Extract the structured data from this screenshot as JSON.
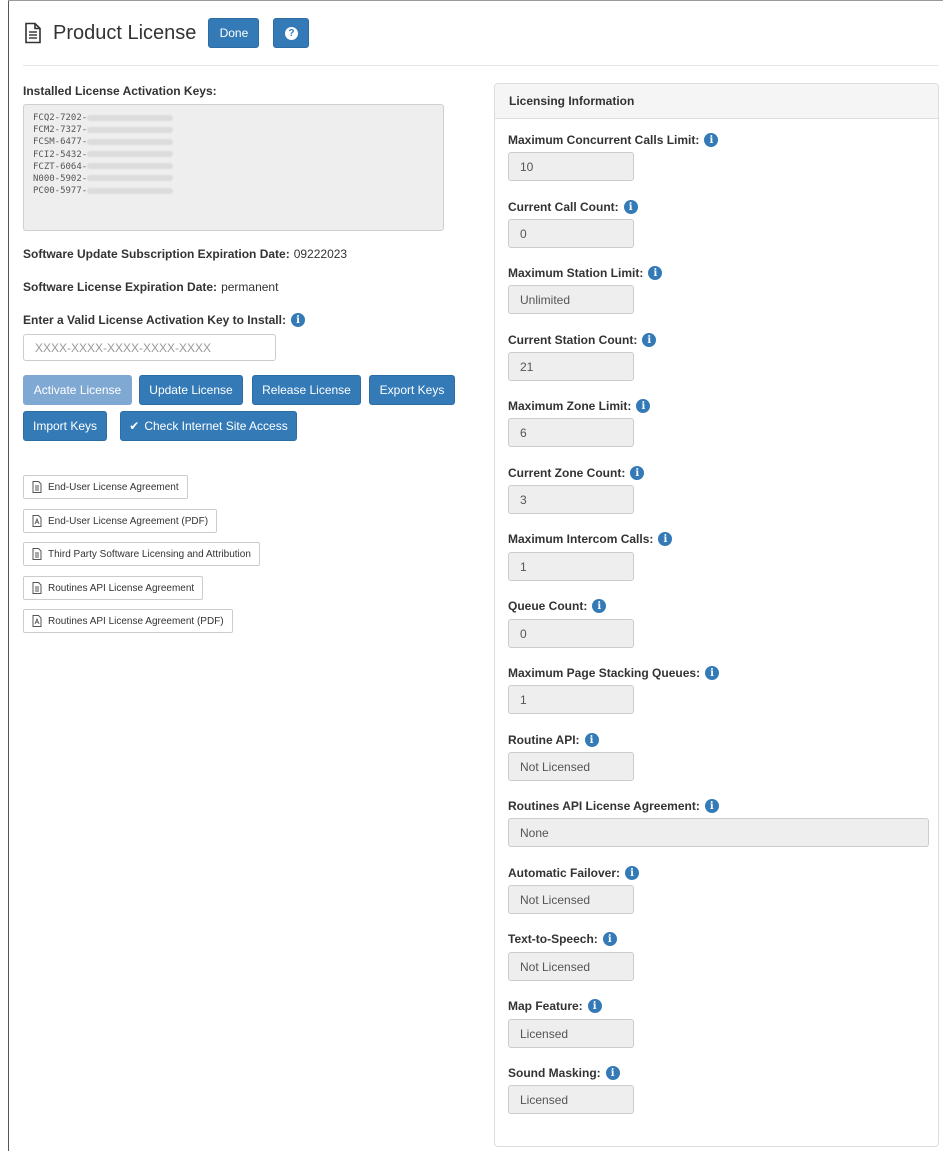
{
  "header": {
    "title": "Product License",
    "done_label": "Done",
    "help_symbol": "?"
  },
  "left": {
    "keys_label": "Installed License Activation Keys:",
    "keys": [
      "FCQ2-7202-",
      "FCM2-7327-",
      "FCSM-6477-",
      "FCI2-5432-",
      "FCZT-6064-",
      "N000-5902-",
      "PC00-5977-"
    ],
    "subscription_label": "Software Update Subscription Expiration Date:",
    "subscription_value": "09222023",
    "license_expiration_label": "Software License Expiration Date:",
    "license_expiration_value": "permanent",
    "enter_key_label": "Enter a Valid License Activation Key to Install:",
    "key_placeholder": "XXXX-XXXX-XXXX-XXXX-XXXX",
    "buttons": {
      "activate": "Activate License",
      "update": "Update License",
      "release": "Release License",
      "export": "Export Keys",
      "import": "Import Keys",
      "check": "Check Internet Site Access"
    },
    "documents": [
      "End-User License Agreement",
      "End-User License Agreement (PDF)",
      "Third Party Software Licensing and Attribution",
      "Routines API License Agreement",
      "Routines API License Agreement (PDF)"
    ]
  },
  "panel": {
    "title": "Licensing Information",
    "fields": [
      {
        "label": "Maximum Concurrent Calls Limit:",
        "value": "10"
      },
      {
        "label": "Current Call Count:",
        "value": "0"
      },
      {
        "label": "Maximum Station Limit:",
        "value": "Unlimited"
      },
      {
        "label": "Current Station Count:",
        "value": "21"
      },
      {
        "label": "Maximum Zone Limit:",
        "value": "6"
      },
      {
        "label": "Current Zone Count:",
        "value": "3"
      },
      {
        "label": "Maximum Intercom Calls:",
        "value": "1"
      },
      {
        "label": "Queue Count:",
        "value": "0"
      },
      {
        "label": "Maximum Page Stacking Queues:",
        "value": "1"
      },
      {
        "label": "Routine API:",
        "value": "Not Licensed"
      },
      {
        "label": "Routines API License Agreement:",
        "value": "None"
      },
      {
        "label": "Automatic Failover:",
        "value": "Not Licensed"
      },
      {
        "label": "Text-to-Speech:",
        "value": "Not Licensed"
      },
      {
        "label": "Map Feature:",
        "value": "Licensed"
      },
      {
        "label": "Sound Masking:",
        "value": "Licensed"
      }
    ]
  },
  "colors": {
    "primary": "#337ab7",
    "primary_disabled": "#7fa9d3",
    "readonly_bg": "#eeeeee"
  }
}
